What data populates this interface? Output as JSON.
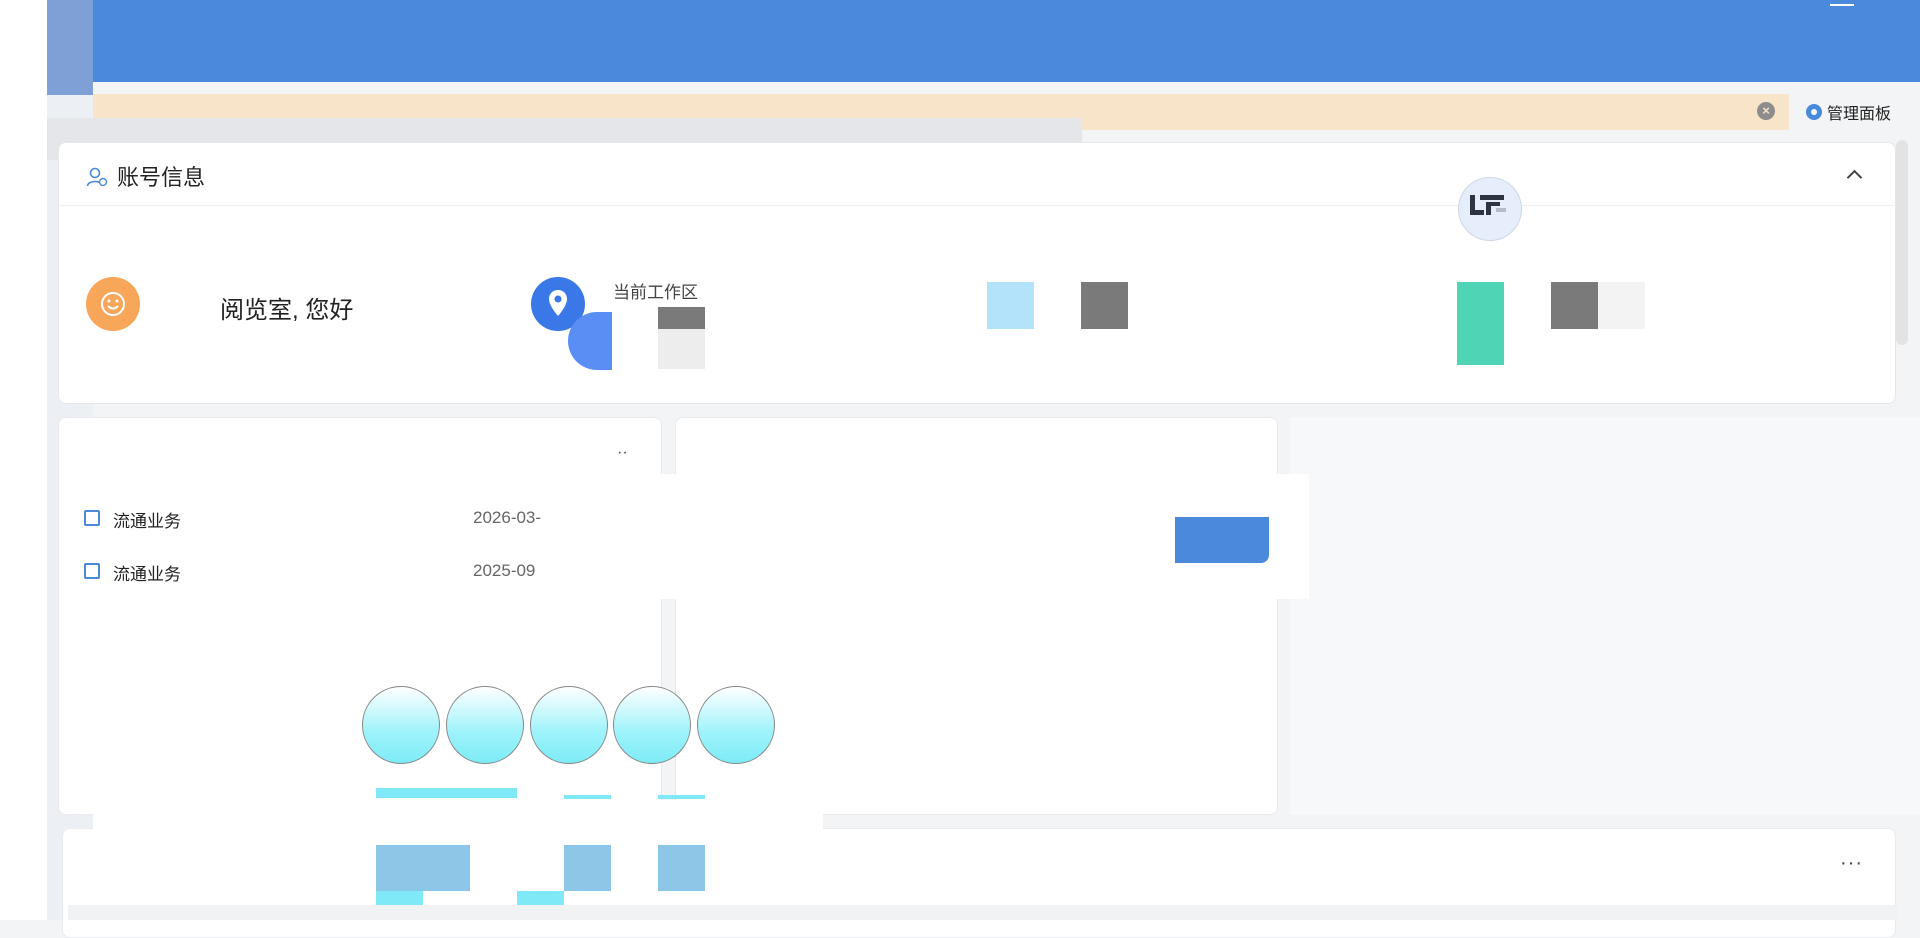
{
  "notice": {
    "close_icon": "×"
  },
  "admin_panel": {
    "label": "管理面板",
    "icon": "gear-icon"
  },
  "account": {
    "title": "账号信息",
    "greeting": "阅览室, 您好",
    "workspace_label": "当前工作区"
  },
  "records": [
    {
      "label": "流通业务",
      "date": "2026-03-"
    },
    {
      "label": "流通业务",
      "date": "2025-09"
    }
  ],
  "left_card": {
    "menu": "··"
  },
  "bottom_card": {
    "menu": "···"
  },
  "colors": {
    "header_blue": "#4a89dc",
    "banner": "#f8e4c8",
    "avatar": "#f7a65a",
    "teal": "#4fd4b6",
    "bubble": "#9ef3fb"
  }
}
